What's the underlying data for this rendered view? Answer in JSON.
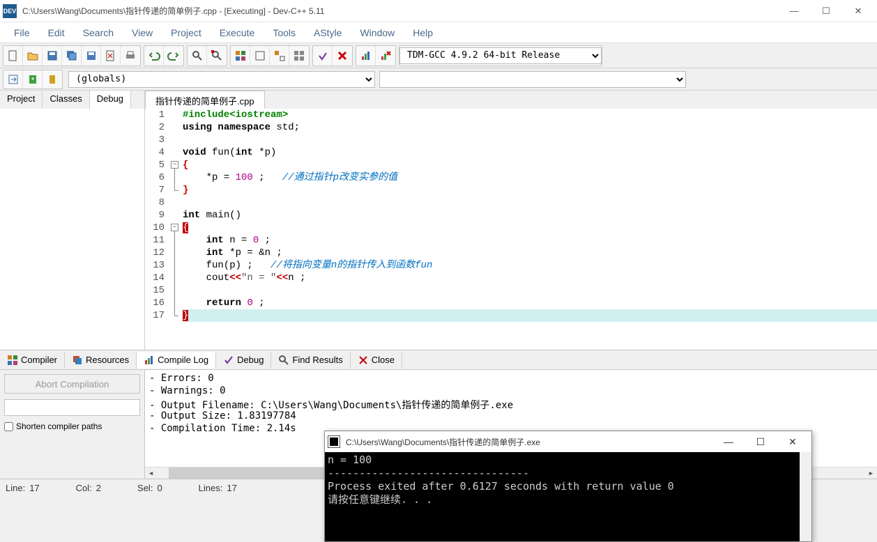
{
  "window": {
    "title": "C:\\Users\\Wang\\Documents\\指针传递的简单例子.cpp - [Executing] - Dev-C++ 5.11",
    "icon_label": "DEV"
  },
  "menus": [
    "File",
    "Edit",
    "Search",
    "View",
    "Project",
    "Execute",
    "Tools",
    "AStyle",
    "Window",
    "Help"
  ],
  "compiler_select": "TDM-GCC 4.9.2 64-bit Release",
  "globals_dd": "(globals)",
  "left_tabs": [
    "Project",
    "Classes",
    "Debug"
  ],
  "left_active": 2,
  "editor_tab": "指针传递的简单例子.cpp",
  "code_lines": [
    {
      "n": 1,
      "html": "<span class='pp'>#include&lt;iostream&gt;</span>"
    },
    {
      "n": 2,
      "html": "<span class='kw'>using</span> <span class='kw'>namespace</span> std;"
    },
    {
      "n": 3,
      "html": ""
    },
    {
      "n": 4,
      "html": "<span class='kw'>void</span> fun(<span class='kw'>int</span> *p)"
    },
    {
      "n": 5,
      "html": "<span class='br'>{</span>"
    },
    {
      "n": 6,
      "html": "    *p = <span class='nm'>100</span> ;   <span class='cm'>//通过指针p改变实参的值</span>"
    },
    {
      "n": 7,
      "html": "<span class='br'>}</span>"
    },
    {
      "n": 8,
      "html": ""
    },
    {
      "n": 9,
      "html": "<span class='kw'>int</span> main()"
    },
    {
      "n": 10,
      "html": "<span class='brhl'>{</span>"
    },
    {
      "n": 11,
      "html": "    <span class='kw'>int</span> n = <span class='nm'>0</span> ;"
    },
    {
      "n": 12,
      "html": "    <span class='kw'>int</span> *p = &amp;n ;"
    },
    {
      "n": 13,
      "html": "    fun(p) ;   <span class='cm'>//将指向变量n的指针传入到函数fun</span>"
    },
    {
      "n": 14,
      "html": "    cout<span class='br'>&lt;&lt;</span><span class='str'>\"n = \"</span><span class='br'>&lt;&lt;</span>n ;"
    },
    {
      "n": 15,
      "html": ""
    },
    {
      "n": 16,
      "html": "    <span class='kw'>return</span> <span class='nm'>0</span> ;"
    },
    {
      "n": 17,
      "html": "<span class='brhl'>}</span>",
      "hl": true
    }
  ],
  "bottom_tabs": [
    {
      "icon": "grid",
      "label": "Compiler"
    },
    {
      "icon": "stack",
      "label": "Resources"
    },
    {
      "icon": "bars",
      "label": "Compile Log"
    },
    {
      "icon": "check",
      "label": "Debug"
    },
    {
      "icon": "search",
      "label": "Find Results"
    },
    {
      "icon": "x",
      "label": "Close"
    }
  ],
  "bottom_active": 2,
  "abort_btn": "Abort Compilation",
  "shorten_label": "Shorten compiler paths",
  "compile_log": [
    "- Errors: 0",
    "- Warnings: 0",
    "- Output Filename: C:\\Users\\Wang\\Documents\\指针传递的简单例子.exe",
    "- Output Size: 1.83197784",
    "- Compilation Time: 2.14s"
  ],
  "status": {
    "line_lbl": "Line:",
    "line": "17",
    "col_lbl": "Col:",
    "col": "2",
    "sel_lbl": "Sel:",
    "sel": "0",
    "lines_lbl": "Lines:",
    "lines": "17"
  },
  "console": {
    "title": "C:\\Users\\Wang\\Documents\\指针传递的简单例子.exe",
    "lines": [
      "n = 100",
      "--------------------------------",
      "Process exited after 0.6127 seconds with return value 0",
      "请按任意键继续. . ."
    ]
  }
}
